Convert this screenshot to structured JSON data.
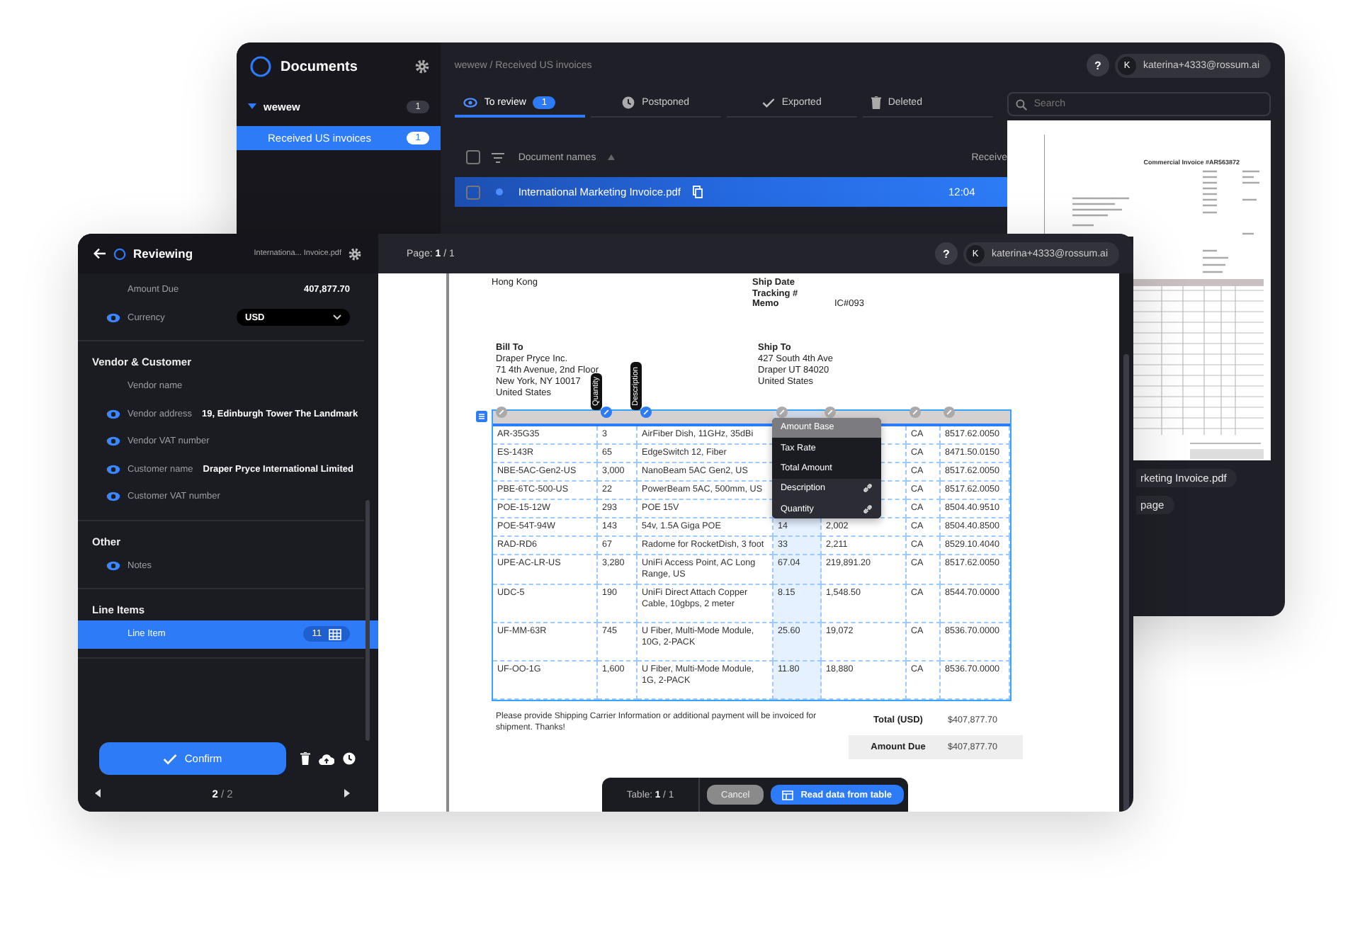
{
  "back_window": {
    "sidebar": {
      "title": "Documents",
      "tree": [
        {
          "label": "wewew",
          "count": "1",
          "expanded": true,
          "selected": false,
          "children": [
            {
              "label": "Received US invoices",
              "count": "1",
              "selected": true
            }
          ]
        }
      ]
    },
    "breadcrumb": "wewew / Received US invoices",
    "help": "?",
    "user": {
      "initial": "K",
      "email": "katerina+4333@rossum.ai"
    },
    "tabs": [
      {
        "kind": "review",
        "label": "To review",
        "count": "1",
        "selected": true
      },
      {
        "kind": "postponed",
        "label": "Postponed",
        "selected": false
      },
      {
        "kind": "exported",
        "label": "Exported",
        "selected": false
      },
      {
        "kind": "deleted",
        "label": "Deleted",
        "selected": false
      }
    ],
    "search": {
      "placeholder": "Search"
    },
    "documents": {
      "header_checked": false,
      "columns": [
        "Document names",
        "Receive"
      ],
      "rows": [
        {
          "name": "International Marketing Invoice.pdf",
          "received": "12:04",
          "checked": false,
          "unread": true,
          "selected": true
        }
      ]
    },
    "preview": {
      "title": "Commercial Invoice #AR563872",
      "file_name": "rketing Invoice.pdf",
      "pages": "page"
    }
  },
  "front_window": {
    "review_panel": {
      "title": "Reviewing",
      "file_name": "Internationa... Invoice.pdf",
      "sections": [
        {
          "fields": [
            {
              "kind": "text",
              "label": "Amount Due",
              "value": "407,877.70",
              "eye": false,
              "selected": false
            },
            {
              "kind": "select",
              "label": "Currency",
              "value": "USD",
              "eye": true,
              "selected": false
            }
          ]
        },
        {
          "title": "Vendor & Customer",
          "fields": [
            {
              "kind": "text",
              "label": "Vendor name",
              "eye": false,
              "selected": false
            },
            {
              "kind": "text",
              "label": "Vendor address",
              "value": "19, Edinburgh Tower The Landmark",
              "eye": true,
              "selected": false
            },
            {
              "kind": "text",
              "label": "Vendor VAT number",
              "eye": true,
              "selected": false
            },
            {
              "kind": "text",
              "label": "Customer name",
              "value": "Draper Pryce International Limited",
              "eye": true,
              "selected": false
            },
            {
              "kind": "text",
              "label": "Customer VAT number",
              "eye": true,
              "selected": false
            }
          ]
        },
        {
          "title": "Other",
          "fields": [
            {
              "kind": "text",
              "label": "Notes",
              "eye": true,
              "selected": false
            }
          ]
        },
        {
          "title": "Line Items",
          "fields": [
            {
              "kind": "table",
              "label": "Line Item",
              "count": "11",
              "eye": false,
              "selected": true
            }
          ]
        }
      ],
      "confirm": "Confirm",
      "pager": "**2** / 2"
    },
    "document": {
      "page_label": "Page: **1** / 1",
      "help": "?",
      "user": {
        "initial": "K",
        "email": "katerina+4333@rossum.ai"
      },
      "sender_lines": [
        "Hong Kong"
      ],
      "meta": [
        {
          "label": "Ship Date"
        },
        {
          "label": "Tracking #"
        },
        {
          "label": "Memo",
          "value": "IC#093"
        }
      ],
      "bill_to": {
        "title": "Bill To",
        "lines": [
          "Draper Pryce Inc.",
          "71 4th Avenue, 2nd Floor",
          "New York, NY 10017",
          "United States"
        ]
      },
      "ship_to": {
        "title": "Ship To",
        "lines": [
          "427 South 4th Ave",
          "Draper UT 84020",
          "United States"
        ]
      },
      "line_table": {
        "columns": [
          {
            "mapped": false,
            "selected": false
          },
          {
            "tag": "Quantity",
            "mapped": true,
            "selected": false
          },
          {
            "tag": "Description",
            "mapped": true,
            "selected": false
          },
          {
            "mapped": false,
            "selected": true
          },
          {
            "mapped": false,
            "selected": false
          },
          {
            "mapped": false,
            "selected": false
          },
          {
            "mapped": false,
            "selected": false
          }
        ],
        "rows": [
          [
            "AR-35G35",
            "3",
            "AirFiber Dish, 11GHz, 35dBi",
            null,
            null,
            "CA",
            "8517.62.0050"
          ],
          [
            "ES-143R",
            "65",
            "EdgeSwitch 12, Fiber",
            null,
            null,
            "CA",
            "8471.50.0150"
          ],
          [
            "NBE-5AC-Gen2-US",
            "3,000",
            "NanoBeam 5AC Gen2, US",
            null,
            null,
            "CA",
            "8517.62.0050"
          ],
          [
            "PBE-6TC-500-US",
            "22",
            "PowerBeam 5AC, 500mm, US",
            null,
            null,
            "CA",
            "8517.62.0050"
          ],
          [
            "POE-15-12W",
            "293",
            "POE 15V",
            null,
            null,
            "CA",
            "8504.40.9510"
          ],
          [
            "POE-54T-94W",
            "143",
            "54v, 1.5A Giga POE",
            "14",
            "2,002",
            "CA",
            "8504.40.8500"
          ],
          [
            "RAD-RD6",
            "67",
            "Radome for RocketDish, 3 foot",
            "33",
            "2,211",
            "CA",
            "8529.10.4040"
          ],
          [
            "UPE-AC-LR-US",
            "3,280",
            "UniFi Access Point, AC Long Range, US",
            "67.04",
            "219,891.20",
            "CA",
            "8517.62.0050"
          ],
          [
            "UDC-5",
            "190",
            "UniFi Direct Attach Copper Cable, 10gbps, 2 meter",
            "8.15",
            "1,548.50",
            "CA",
            "8544.70.0000"
          ],
          [
            "UF-MM-63R",
            "745",
            "U Fiber, Multi-Mode Module, 10G, 2-PACK",
            "25.60",
            "19,072",
            "CA",
            "8536.70.0000"
          ],
          [
            "UF-OO-1G",
            "1,600",
            "U Fiber, Multi-Mode Module, 1G, 2-PACK",
            "11.80",
            "18,880",
            "CA",
            "8536.70.0000"
          ]
        ]
      },
      "column_menu": [
        {
          "label": "Amount Base",
          "selected": true,
          "assigned": false
        },
        {
          "label": "Tax Rate",
          "selected": false,
          "assigned": false
        },
        {
          "label": "Total Amount",
          "selected": false,
          "assigned": false
        },
        {
          "label": "Description",
          "selected": false,
          "assigned": true
        },
        {
          "label": "Quantity",
          "selected": false,
          "assigned": true
        }
      ],
      "note": "Please provide Shipping Carrier Information or additional payment will be invoiced for shipment. Thanks!",
      "total": {
        "label": "Total (USD)",
        "value": "$407,877.70"
      },
      "amount_due": {
        "label": "Amount Due",
        "value": "$407,877.70"
      },
      "table_bar": {
        "counter": "Table: **1** / 1",
        "cancel": "Cancel",
        "read": "Read data from table"
      }
    }
  }
}
